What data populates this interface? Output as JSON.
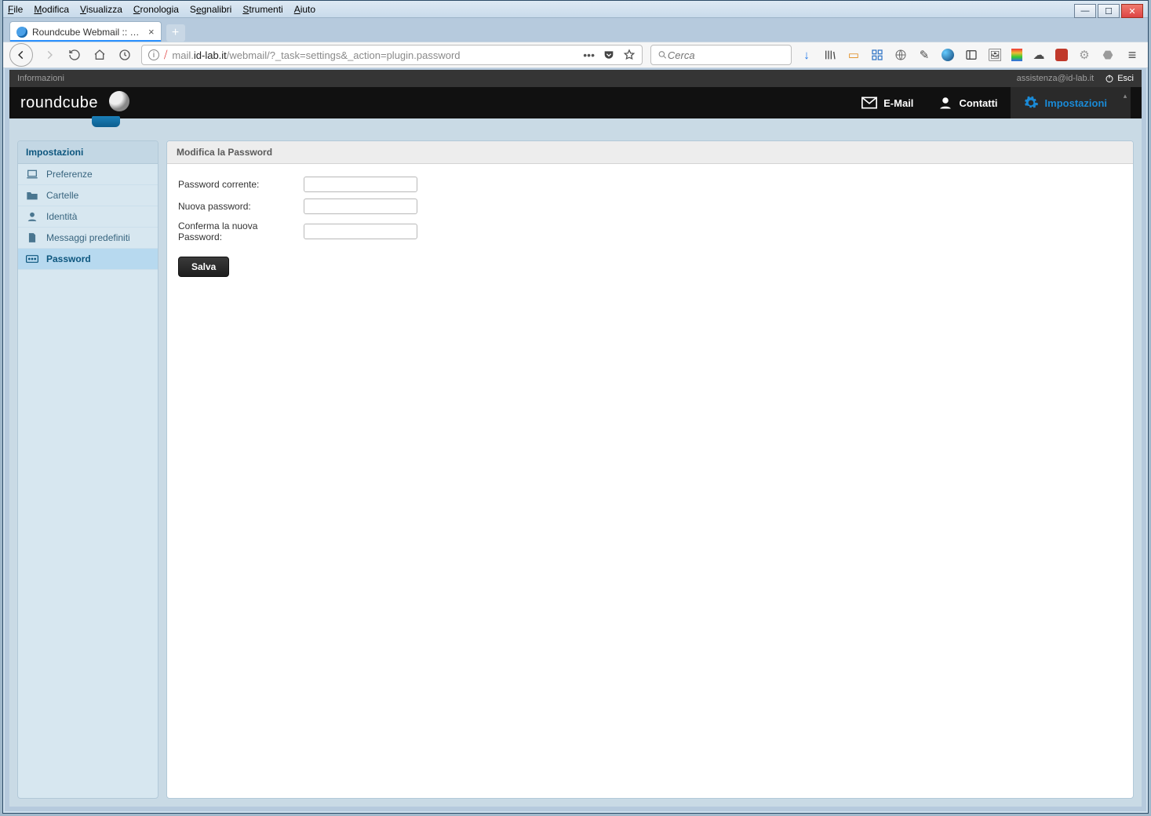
{
  "os_menu": {
    "file": "File",
    "modifica": "Modifica",
    "visualizza": "Visualizza",
    "cronologia": "Cronologia",
    "segnalibri": "Segnalibri",
    "strumenti": "Strumenti",
    "aiuto": "Aiuto"
  },
  "browser": {
    "tab_title": "Roundcube Webmail :: Modific…",
    "url_host": "mail.id-lab.it",
    "url_prefix": "mail.",
    "url_host_bold": "id-lab.it",
    "url_path": "/webmail/?_task=settings&_action=plugin.password",
    "search_placeholder": "Cerca"
  },
  "infobar": {
    "left": "Informazioni",
    "email": "assistenza@id-lab.it",
    "logout": "Esci"
  },
  "logo_text": "roundcube",
  "topnav": {
    "email": "E-Mail",
    "contacts": "Contatti",
    "settings": "Impostazioni"
  },
  "sidebar": {
    "header": "Impostazioni",
    "items": [
      {
        "label": "Preferenze",
        "icon": "laptop"
      },
      {
        "label": "Cartelle",
        "icon": "folder"
      },
      {
        "label": "Identità",
        "icon": "person"
      },
      {
        "label": "Messaggi predefiniti",
        "icon": "file"
      },
      {
        "label": "Password",
        "icon": "password",
        "active": true
      }
    ]
  },
  "panel": {
    "title": "Modifica la Password",
    "current_label": "Password corrente:",
    "new_label": "Nuova password:",
    "confirm_label": "Conferma la nuova Password:",
    "save": "Salva"
  }
}
